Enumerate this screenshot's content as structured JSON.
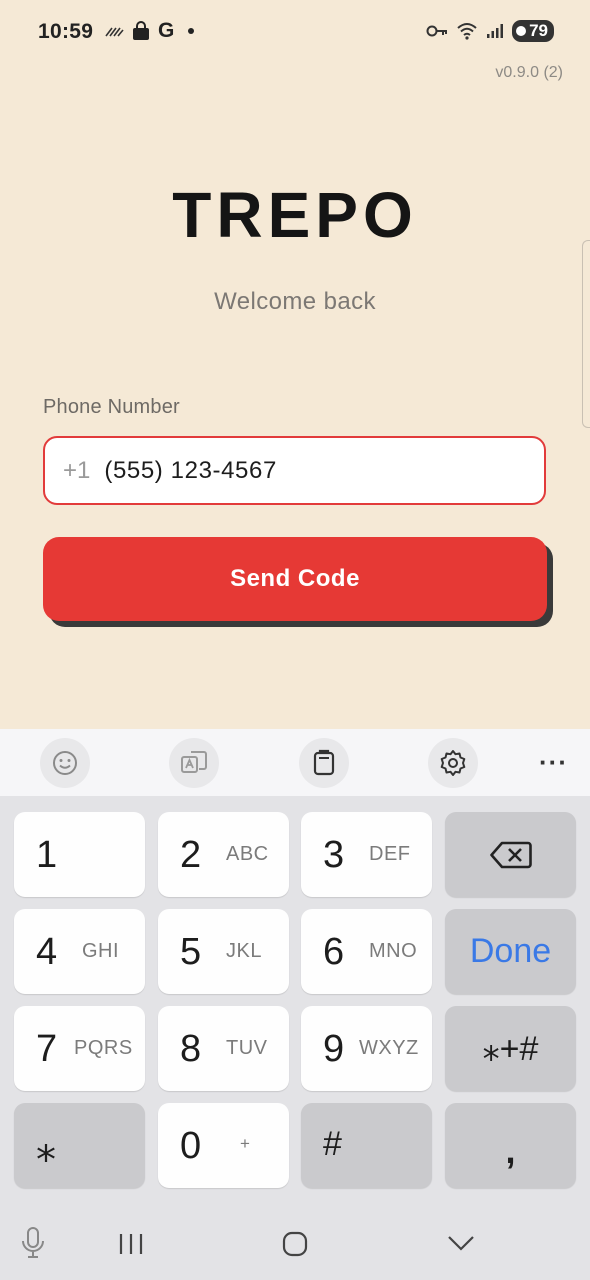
{
  "status_bar": {
    "time": "10:59",
    "notif_g": "G",
    "battery": "79"
  },
  "app": {
    "version": "v0.9.0 (2)",
    "title": "TREPO",
    "subtitle": "Welcome back"
  },
  "form": {
    "phone_label": "Phone Number",
    "country_code": "+1",
    "phone_value": "(555) 123-4567",
    "send_label": "Send Code"
  },
  "keyboard": {
    "toolbar": [
      "emoji-icon",
      "translate-icon",
      "clipboard-icon",
      "settings-icon",
      "more-icon"
    ],
    "more_label": "···",
    "keys": [
      {
        "digit": "1",
        "letters": ""
      },
      {
        "digit": "2",
        "letters": "ABC"
      },
      {
        "digit": "3",
        "letters": "DEF"
      },
      {
        "digit": "4",
        "letters": "GHI"
      },
      {
        "digit": "5",
        "letters": "JKL"
      },
      {
        "digit": "6",
        "letters": "MNO"
      },
      {
        "digit": "7",
        "letters": "PQRS"
      },
      {
        "digit": "8",
        "letters": "TUV"
      },
      {
        "digit": "9",
        "letters": "WXYZ"
      },
      {
        "digit": "0",
        "letters": "+"
      }
    ],
    "done_label": "Done",
    "sym_label": "⁎+#",
    "star_label": "⁎",
    "hash_label": "#",
    "comma_label": ","
  },
  "colors": {
    "background": "#F5E9D6",
    "accent": "#E63935",
    "done_blue": "#3a79e6"
  }
}
